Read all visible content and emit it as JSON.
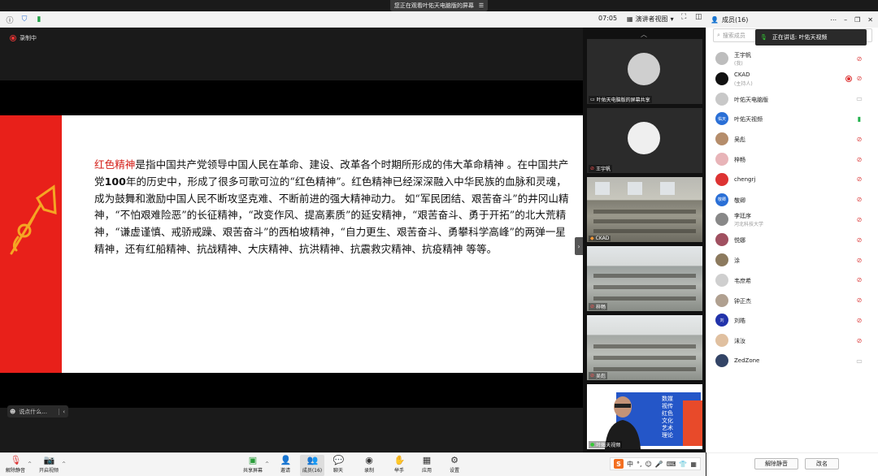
{
  "banner": {
    "text": "您正在观看叶佑天电脑版的屏幕",
    "menu_icon": "menu-icon"
  },
  "topbar": {
    "timer": "07:05",
    "view_label": "演讲者视图"
  },
  "stage": {
    "recording_label": "录制中",
    "chat_placeholder": "说点什么...",
    "slide": {
      "highlight": "红色精神",
      "paragraph_before_bold": "是指中国共产党领导中国人民在革命、建设、改革各个时期所形成的伟大革命精神 。在中国共产党",
      "bold": "100",
      "paragraph_after_bold": "年的历史中，形成了很多可歌可泣的“红色精神”。红色精神已经深深融入中华民族的血脉和灵魂，成为鼓舞和激励中国人民不断攻坚克难、不断前进的强大精神动力。 如“军民团结、艰苦奋斗”的井冈山精神，“不怕艰难险恶”的长征精神，“改变作风、提高素质”的延安精神，“艰苦奋斗、勇于开拓”的北大荒精神，“谦虚谨慎、戒骄戒躁、艰苦奋斗”的西柏坡精神，“自力更生、艰苦奋斗、勇攀科学高峰”的两弹一星精神，还有红船精神、抗战精神、大庆精神、抗洪精神、抗震救灾精神、抗疫精神 等等。"
    }
  },
  "thumbnails": [
    {
      "label": "叶佑天电脑版的屏幕共享"
    },
    {
      "label": "王宇帆"
    },
    {
      "label": "CKAD"
    },
    {
      "label": "梓畅"
    },
    {
      "label": "吴彪"
    },
    {
      "label": "叶佑天视频",
      "poster_lines": [
        "数媒",
        "视传",
        "红色",
        "文化",
        "艺术",
        "理论"
      ]
    }
  ],
  "members_panel": {
    "title": "成员(16)",
    "search_placeholder": "搜索成员",
    "speaking_label": "正在讲话: 叶佑天视频",
    "members": [
      {
        "name": "王宇帆",
        "sub": "(我)",
        "mic": "muted"
      },
      {
        "name": "CKAD",
        "sub": "(主持人)",
        "mic": "muted",
        "recording": true
      },
      {
        "name": "叶佑天电脑版",
        "sub": "",
        "mic": "none"
      },
      {
        "name": "叶佑天视频",
        "sub": "",
        "mic": "on",
        "avatar_text": "佑天"
      },
      {
        "name": "吴彪",
        "sub": "",
        "mic": "muted"
      },
      {
        "name": "梓畅",
        "sub": "",
        "mic": "muted"
      },
      {
        "name": "chengrj",
        "sub": "",
        "mic": "muted"
      },
      {
        "name": "敬卿",
        "sub": "",
        "mic": "muted",
        "avatar_text": "敬卿"
      },
      {
        "name": "李廷序",
        "sub": "河北科技大学",
        "mic": "muted"
      },
      {
        "name": "悦娜",
        "sub": "",
        "mic": "muted"
      },
      {
        "name": "涂",
        "sub": "",
        "mic": "muted"
      },
      {
        "name": "韦庶希",
        "sub": "",
        "mic": "muted"
      },
      {
        "name": "钟正杰",
        "sub": "",
        "mic": "muted"
      },
      {
        "name": "刘皓",
        "sub": "",
        "mic": "muted",
        "avatar_text": "刘"
      },
      {
        "name": "沫汝",
        "sub": "",
        "mic": "muted"
      },
      {
        "name": "ZedZone",
        "sub": "",
        "mic": "none"
      }
    ],
    "unmute_all": "解除静音",
    "rename": "改名"
  },
  "toolbar": {
    "unmute": "解除静音",
    "start_video": "开启视频",
    "share_screen": "共享屏幕",
    "invite": "邀请",
    "members": "成员(16)",
    "chat": "聊天",
    "record": "录制",
    "raise_hand": "举手",
    "apps": "应用",
    "settings": "设置"
  },
  "ime": {
    "lang": "中"
  }
}
